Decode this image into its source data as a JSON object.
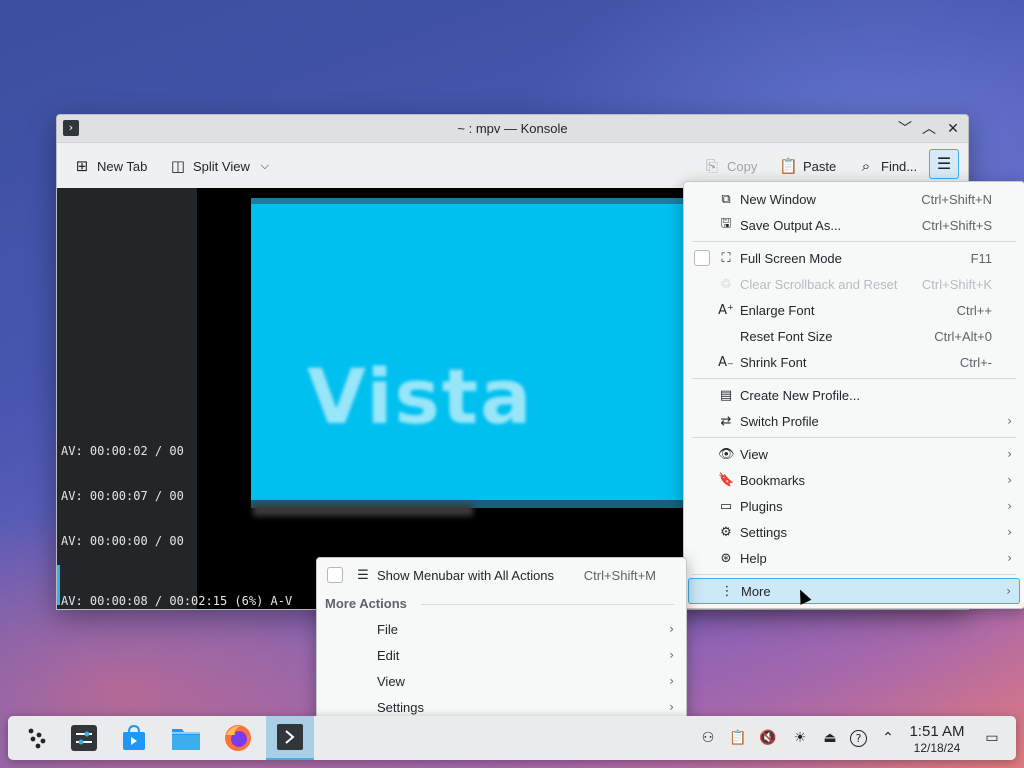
{
  "window": {
    "title": "~ : mpv — Konsole",
    "app_icon": "›",
    "controls": {
      "minimize": "﹀",
      "maximize": "︿",
      "close": "✕"
    }
  },
  "toolbar": {
    "new_tab": "New Tab",
    "split_view": "Split View",
    "copy": "Copy",
    "paste": "Paste",
    "find": "Find...",
    "menu_icon": "☰"
  },
  "terminal": {
    "lines": [
      "AV: 00:00:02 / 00",
      "AV: 00:00:07 / 00",
      "AV: 00:00:00 / 00",
      "AV: 00:00:08 / 00:02:15 (6%) A-V"
    ],
    "video_text": "Vista"
  },
  "main_menu": {
    "items": [
      {
        "label": "New Window",
        "shortcut": "Ctrl+Shift+N",
        "icon": "⧉"
      },
      {
        "label": "Save Output As...",
        "shortcut": "Ctrl+Shift+S",
        "icon": "🖫"
      },
      {
        "label": "Full Screen Mode",
        "shortcut": "F11",
        "icon": "⛶"
      },
      {
        "label": "Clear Scrollback and Reset",
        "shortcut": "Ctrl+Shift+K",
        "icon": "♲"
      },
      {
        "label": "Enlarge Font",
        "shortcut": "Ctrl++",
        "icon": "A⁺"
      },
      {
        "label": "Reset Font Size",
        "shortcut": "Ctrl+Alt+0",
        "icon": ""
      },
      {
        "label": "Shrink Font",
        "shortcut": "Ctrl+-",
        "icon": "A₋"
      },
      {
        "label": "Create New Profile...",
        "icon": "▤"
      },
      {
        "label": "Switch Profile",
        "icon": "⇄"
      },
      {
        "label": "View",
        "icon": "👁"
      },
      {
        "label": "Bookmarks",
        "icon": "🔖"
      },
      {
        "label": "Plugins",
        "icon": "▭"
      },
      {
        "label": "Settings",
        "icon": "⚙"
      },
      {
        "label": "Help",
        "icon": "⊛"
      },
      {
        "label": "More",
        "icon": "⋮"
      }
    ],
    "arrow": "›"
  },
  "sub_menu": {
    "show_menubar": {
      "label": "Show Menubar with All Actions",
      "shortcut": "Ctrl+Shift+M",
      "icon": "☰"
    },
    "section_title": "More Actions",
    "items": [
      "File",
      "Edit",
      "View",
      "Settings"
    ],
    "arrow": "›"
  },
  "taskbar": {
    "apps": [
      {
        "name": "application-launcher",
        "glyph": "⁘"
      },
      {
        "name": "system-settings",
        "glyph": "⚌"
      },
      {
        "name": "discover",
        "glyph": "🛍"
      },
      {
        "name": "dolphin",
        "glyph": "📁"
      },
      {
        "name": "firefox",
        "glyph": "◉"
      },
      {
        "name": "konsole",
        "glyph": "›"
      }
    ],
    "tray": {
      "network": "⚇",
      "clipboard": "📋",
      "volume": "🔇",
      "brightness": "☀",
      "usb": "⏏",
      "help": "?",
      "expand": "⌃",
      "show_desktop": "▭"
    },
    "clock": {
      "time": "1:51 AM",
      "date": "12/18/24"
    }
  },
  "colors": {
    "accent": "#3daee9",
    "video_bg": "#00c0f0",
    "highlight": "#cde8f6"
  }
}
